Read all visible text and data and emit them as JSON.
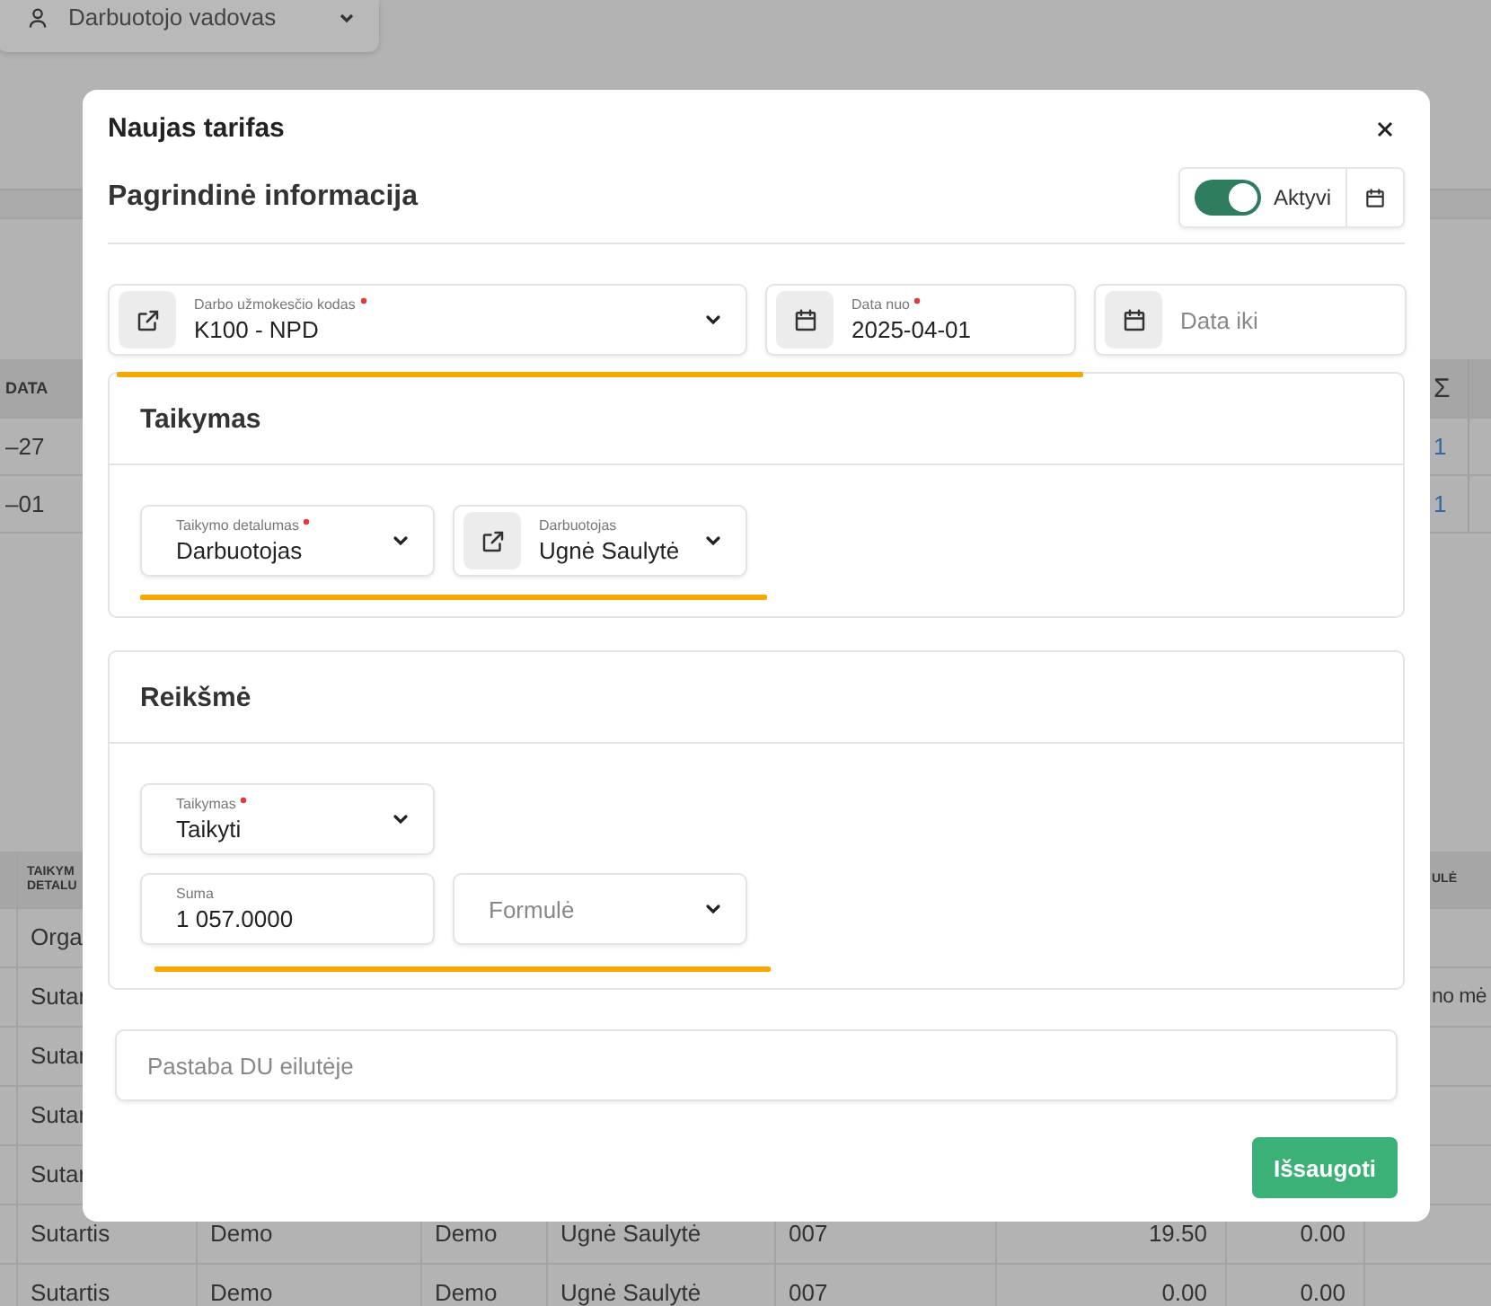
{
  "background": {
    "filter": {
      "value": "Darbuotojo vadovas"
    },
    "table_1": {
      "columns": {
        "column_1": "DATA",
        "column_2": "Σ"
      },
      "rows": [
        {
          "column_1": "–27",
          "column_2": "1"
        },
        {
          "column_1": "–01",
          "column_2": "1"
        }
      ]
    },
    "table_2": {
      "columns": {
        "column_1": "TAIKYM\nDETALU",
        "column_8": "ULĖ"
      },
      "rows": [
        {
          "column_1": "Orga"
        },
        {
          "column_1": "Sutar",
          "column_8": "no mė"
        },
        {
          "column_1": "Sutar"
        },
        {
          "column_1": "Sutar"
        },
        {
          "column_1": "Sutar"
        },
        {
          "column_1": "Sutartis",
          "column_2": "Demo",
          "column_3": "Demo",
          "column_4": "Ugnė Saulytė",
          "column_5": "007",
          "column_6": "19.50",
          "column_7": "0.00"
        },
        {
          "column_1": "Sutartis",
          "column_2": "Demo",
          "column_3": "Demo",
          "column_4": "Ugnė Saulytė",
          "column_5": "007",
          "column_6": "0.00",
          "column_7": "0.00"
        }
      ]
    }
  },
  "dialog": {
    "title": "Naujas tarifas",
    "section_title": "Pagrindinė informacija",
    "active_toggle": {
      "label": "Aktyvi",
      "on": true
    },
    "fields": [
      {
        "kind": "link_select",
        "label": "Darbo užmokesčio kodas",
        "required": true,
        "value": "K100 - NPD"
      },
      {
        "kind": "date",
        "label": "Data nuo",
        "required": true,
        "value": "2025-04-01"
      },
      {
        "kind": "date",
        "placeholder": "Data iki"
      }
    ],
    "sections": [
      {
        "title": "Taikymas",
        "rows": [
          [
            {
              "kind": "select",
              "label": "Taikymo detalumas",
              "required": true,
              "value": "Darbuotojas"
            },
            {
              "kind": "link_select",
              "label": "Darbuotojas",
              "required": false,
              "value": "Ugnė Saulytė"
            }
          ]
        ]
      },
      {
        "title": "Reikšmė",
        "rows": [
          [
            {
              "kind": "select",
              "label": "Taikymas",
              "required": true,
              "value": "Taikyti"
            }
          ],
          [
            {
              "kind": "input",
              "label": "Suma",
              "required": false,
              "value": "1 057.0000"
            },
            {
              "kind": "select",
              "placeholder": "Formulė"
            }
          ]
        ]
      }
    ],
    "note": {
      "placeholder": "Pastaba DU eilutėje"
    },
    "save_button": "Išsaugoti"
  }
}
